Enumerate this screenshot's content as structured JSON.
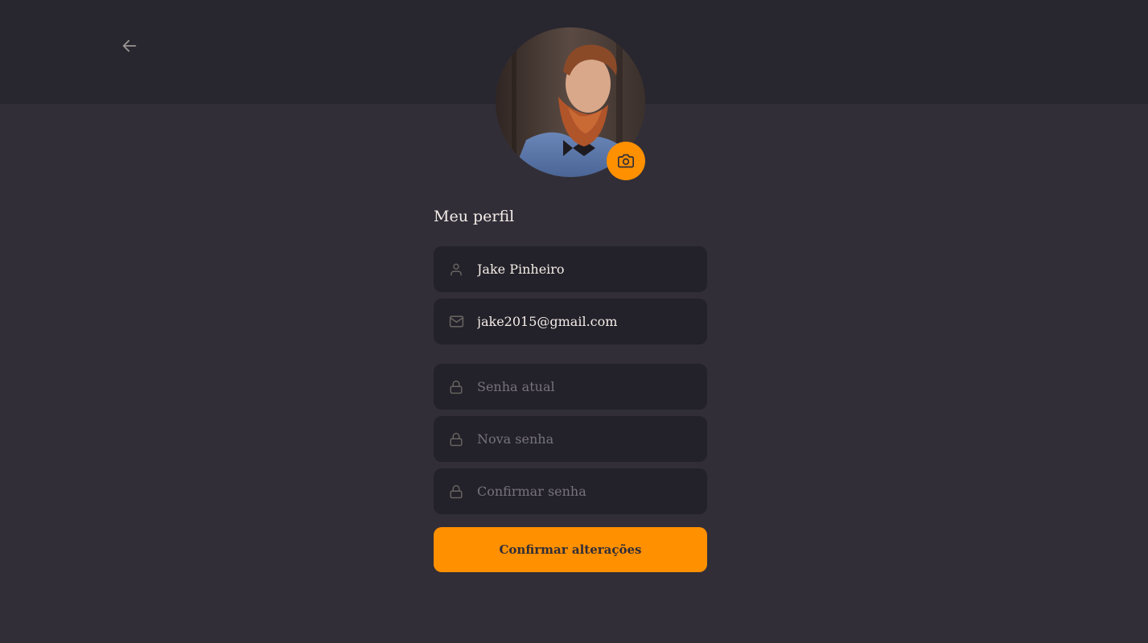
{
  "header": {
    "back_icon": "arrow-left-icon"
  },
  "profile": {
    "avatar_icon": "camera-icon",
    "title": "Meu perfil"
  },
  "form": {
    "name": {
      "icon": "user-icon",
      "value": "Jake Pinheiro",
      "placeholder": ""
    },
    "email": {
      "icon": "mail-icon",
      "value": "jake2015@gmail.com",
      "placeholder": ""
    },
    "old_password": {
      "icon": "lock-icon",
      "value": "",
      "placeholder": "Senha atual"
    },
    "new_password": {
      "icon": "lock-icon",
      "value": "",
      "placeholder": "Nova senha"
    },
    "confirm_password": {
      "icon": "lock-icon",
      "value": "",
      "placeholder": "Confirmar senha"
    },
    "submit_label": "Confirmar alterações"
  },
  "colors": {
    "background": "#312e38",
    "header": "#28262e",
    "input": "#232129",
    "accent": "#ff9000",
    "text": "#f4ede8",
    "placeholder": "#77737e"
  }
}
